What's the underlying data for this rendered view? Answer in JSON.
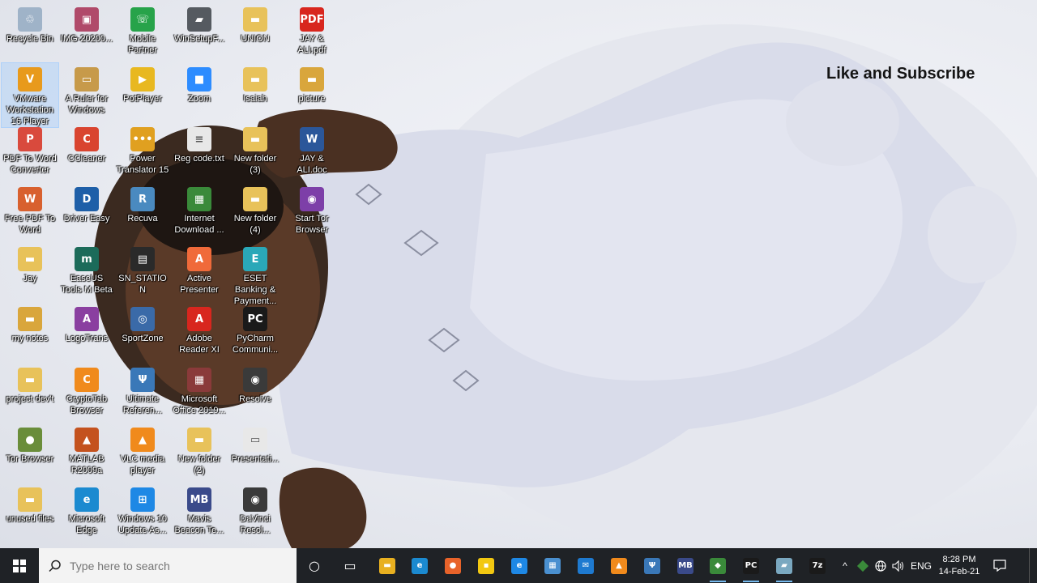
{
  "overlay_text": "Like and Subscribe",
  "desktop_icons": [
    {
      "label": "Recycle Bin",
      "icon": "recycle-bin-icon",
      "color": "#9fb3c8",
      "glyph": "♲"
    },
    {
      "label": "VMware Workstation 16 Player",
      "icon": "vmware-icon",
      "color": "#e89a1c",
      "glyph": "V"
    },
    {
      "label": "PDF To Word Converter",
      "icon": "pdf-converter-icon",
      "color": "#d94a3d",
      "glyph": "P"
    },
    {
      "label": "Free PDF To Word",
      "icon": "free-pdf-icon",
      "color": "#d8602e",
      "glyph": "W"
    },
    {
      "label": "Jay",
      "icon": "folder-icon",
      "color": "#e8c25a",
      "glyph": "▬"
    },
    {
      "label": "my notes",
      "icon": "folder-icon",
      "color": "#d9a63c",
      "glyph": "▬"
    },
    {
      "label": "project dev't",
      "icon": "folder-icon",
      "color": "#e8c25a",
      "glyph": "▬"
    },
    {
      "label": "Tor Browser",
      "icon": "tor-browser-icon",
      "color": "#6a8d3a",
      "glyph": "●"
    },
    {
      "label": "unused files",
      "icon": "folder-icon",
      "color": "#e8c25a",
      "glyph": "▬"
    },
    {
      "label": "IMG-20200...",
      "icon": "image-file-icon",
      "color": "#b04a6a",
      "glyph": "▣"
    },
    {
      "label": "A Ruler for Windows",
      "icon": "ruler-icon",
      "color": "#c79a4a",
      "glyph": "▭"
    },
    {
      "label": "CCleaner",
      "icon": "ccleaner-icon",
      "color": "#d9442f",
      "glyph": "C"
    },
    {
      "label": "Driver Easy",
      "icon": "driver-easy-icon",
      "color": "#1e5fa8",
      "glyph": "D"
    },
    {
      "label": "EaseUS Tools M Beta",
      "icon": "easeus-icon",
      "color": "#1c6b5a",
      "glyph": "m"
    },
    {
      "label": "LogoTrans",
      "icon": "logotrans-icon",
      "color": "#8a3fa0",
      "glyph": "A"
    },
    {
      "label": "CryptoTab Browser",
      "icon": "cryptotab-icon",
      "color": "#f08a1c",
      "glyph": "C"
    },
    {
      "label": "MATLAB R2009a",
      "icon": "matlab-icon",
      "color": "#c4521e",
      "glyph": "▲"
    },
    {
      "label": "Microsoft Edge",
      "icon": "edge-icon",
      "color": "#1b8ad0",
      "glyph": "e"
    },
    {
      "label": "Mobile Partner",
      "icon": "mobile-partner-icon",
      "color": "#27a34a",
      "glyph": "☏"
    },
    {
      "label": "PotPlayer",
      "icon": "potplayer-icon",
      "color": "#e8b820",
      "glyph": "▶"
    },
    {
      "label": "Power Translator 15",
      "icon": "translator-icon",
      "color": "#e0a020",
      "glyph": "•••"
    },
    {
      "label": "Recuva",
      "icon": "recuva-icon",
      "color": "#4a8ac0",
      "glyph": "R"
    },
    {
      "label": "SN_STATION",
      "icon": "sn-station-icon",
      "color": "#2a2a2a",
      "glyph": "▤"
    },
    {
      "label": "SportZone",
      "icon": "sportzone-icon",
      "color": "#3a6aa8",
      "glyph": "◎"
    },
    {
      "label": "Ultimate Referen...",
      "icon": "ultimate-ref-icon",
      "color": "#3a78b8",
      "glyph": "Ψ"
    },
    {
      "label": "VLC media player",
      "icon": "vlc-icon",
      "color": "#f08a1c",
      "glyph": "▲"
    },
    {
      "label": "Windows 10 Update As...",
      "icon": "windows-update-icon",
      "color": "#1e88e5",
      "glyph": "⊞"
    },
    {
      "label": "WinSetupF...",
      "icon": "usb-icon",
      "color": "#555a60",
      "glyph": "▰"
    },
    {
      "label": "Zoom",
      "icon": "zoom-icon",
      "color": "#2d8cff",
      "glyph": "■"
    },
    {
      "label": "Reg code.txt",
      "icon": "text-file-icon",
      "color": "#e8e8e8",
      "glyph": "≡"
    },
    {
      "label": "Internet Download ...",
      "icon": "idm-icon",
      "color": "#3a8a3a",
      "glyph": "▦"
    },
    {
      "label": "Active Presenter",
      "icon": "active-presenter-icon",
      "color": "#f06a3a",
      "glyph": "A"
    },
    {
      "label": "Adobe Reader XI",
      "icon": "adobe-reader-icon",
      "color": "#d8261e",
      "glyph": "A"
    },
    {
      "label": "Microsoft Office 2019...",
      "icon": "office-icon",
      "color": "#8a3a3a",
      "glyph": "▦"
    },
    {
      "label": "New folder (2)",
      "icon": "folder-icon",
      "color": "#e8c25a",
      "glyph": "▬"
    },
    {
      "label": "Mavis Beacon Te...",
      "icon": "mavis-beacon-icon",
      "color": "#3a4a8a",
      "glyph": "MB"
    },
    {
      "label": "UNION",
      "icon": "folder-icon",
      "color": "#e8c25a",
      "glyph": "▬"
    },
    {
      "label": "Isaiah",
      "icon": "folder-icon",
      "color": "#e8c25a",
      "glyph": "▬"
    },
    {
      "label": "New folder (3)",
      "icon": "folder-icon",
      "color": "#e8c25a",
      "glyph": "▬"
    },
    {
      "label": "New folder (4)",
      "icon": "folder-icon",
      "color": "#e8c25a",
      "glyph": "▬"
    },
    {
      "label": "ESET Banking & Payment...",
      "icon": "eset-icon",
      "color": "#2aa8b8",
      "glyph": "E"
    },
    {
      "label": "PyCharm Communi...",
      "icon": "pycharm-icon",
      "color": "#1a1a1a",
      "glyph": "PC"
    },
    {
      "label": "Resolve",
      "icon": "resolve-icon",
      "color": "#3a3a3a",
      "glyph": "◉"
    },
    {
      "label": "Presentati...",
      "icon": "presentation-icon",
      "color": "#e8e8e8",
      "glyph": "▭"
    },
    {
      "label": "DaVinci Resol...",
      "icon": "davinci-icon",
      "color": "#3a3a3a",
      "glyph": "◉"
    },
    {
      "label": "JAY & ALI.pdf",
      "icon": "pdf-file-icon",
      "color": "#d8261e",
      "glyph": "PDF"
    },
    {
      "label": "picture",
      "icon": "folder-icon",
      "color": "#d9a63c",
      "glyph": "▬"
    },
    {
      "label": "JAY & ALI.doc",
      "icon": "word-doc-icon",
      "color": "#2b579a",
      "glyph": "W"
    },
    {
      "label": "Start Tor Browser",
      "icon": "start-tor-icon",
      "color": "#7d3fa8",
      "glyph": "◉"
    }
  ],
  "taskbar": {
    "search_placeholder": "Type here to search",
    "apps": [
      {
        "name": "cortana-button",
        "icon": "cortana-icon",
        "glyph": "○",
        "color": "transparent",
        "running": false
      },
      {
        "name": "task-view-button",
        "icon": "task-view-icon",
        "glyph": "▭",
        "color": "transparent",
        "running": false
      },
      {
        "name": "file-explorer-button",
        "icon": "folder-icon",
        "glyph": "▬",
        "color": "#e8b020",
        "running": false
      },
      {
        "name": "edge-button",
        "icon": "edge-icon",
        "glyph": "e",
        "color": "#1b8ad0",
        "running": false
      },
      {
        "name": "firefox-button",
        "icon": "firefox-icon",
        "glyph": "●",
        "color": "#e8632a",
        "running": false
      },
      {
        "name": "sticky-notes-button",
        "icon": "sticky-notes-icon",
        "glyph": "▪",
        "color": "#f2c811",
        "running": false
      },
      {
        "name": "internet-explorer-button",
        "icon": "ie-icon",
        "glyph": "e",
        "color": "#1e88e5",
        "running": false
      },
      {
        "name": "store-button",
        "icon": "store-icon",
        "glyph": "▦",
        "color": "#4a90d0",
        "running": false
      },
      {
        "name": "mail-button",
        "icon": "mail-icon",
        "glyph": "✉",
        "color": "#1e7ad0",
        "running": false
      },
      {
        "name": "vlc-button",
        "icon": "vlc-icon",
        "glyph": "▲",
        "color": "#f08a1c",
        "running": false
      },
      {
        "name": "ultimate-ref-button",
        "icon": "ultimate-ref-icon",
        "glyph": "Ψ",
        "color": "#3a78b8",
        "running": false
      },
      {
        "name": "mavis-beacon-button",
        "icon": "mavis-beacon-icon",
        "glyph": "MB",
        "color": "#3a4a8a",
        "running": false
      },
      {
        "name": "app-button-green",
        "icon": "app-icon",
        "glyph": "◆",
        "color": "#3a8a3a",
        "running": true
      },
      {
        "name": "pycharm-button",
        "icon": "pycharm-icon",
        "glyph": "PC",
        "color": "#1a1a1a",
        "running": true
      },
      {
        "name": "notes-app-button",
        "icon": "notes-icon",
        "glyph": "▰",
        "color": "#7aa8c0",
        "running": true
      },
      {
        "name": "7zip-button",
        "icon": "7zip-icon",
        "glyph": "7z",
        "color": "#1a1a1a",
        "running": false
      }
    ],
    "tray": {
      "chevron": "^",
      "language": "ENG",
      "time": "8:28 PM",
      "date": "14-Feb-21"
    }
  }
}
